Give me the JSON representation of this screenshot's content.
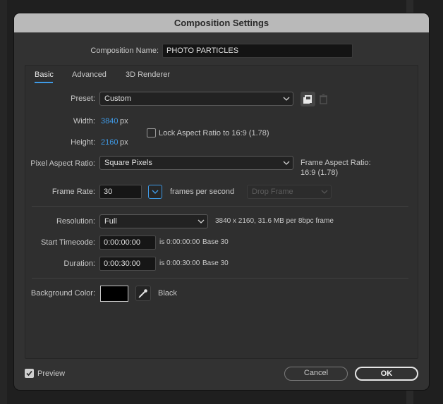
{
  "dialog": {
    "title": "Composition Settings"
  },
  "composition_name": {
    "label": "Composition Name:",
    "value": "PHOTO PARTICLES"
  },
  "tabs": [
    {
      "label": "Basic",
      "active": true
    },
    {
      "label": "Advanced",
      "active": false
    },
    {
      "label": "3D Renderer",
      "active": false
    }
  ],
  "preset": {
    "label": "Preset:",
    "value": "Custom"
  },
  "width": {
    "label": "Width:",
    "value": "3840",
    "unit": "px"
  },
  "height": {
    "label": "Height:",
    "value": "2160",
    "unit": "px"
  },
  "lock_aspect": {
    "label": "Lock Aspect Ratio to 16:9 (1.78)",
    "checked": false
  },
  "pixel_aspect": {
    "label": "Pixel Aspect Ratio:",
    "value": "Square Pixels",
    "frame_aspect_label": "Frame Aspect Ratio:",
    "frame_aspect_value": "16:9 (1.78)"
  },
  "frame_rate": {
    "label": "Frame Rate:",
    "value": "30",
    "unit": "frames per second",
    "drop_frame": "Drop Frame"
  },
  "resolution": {
    "label": "Resolution:",
    "value": "Full",
    "info": "3840 x 2160, 31.6 MB per 8bpc frame"
  },
  "start_timecode": {
    "label": "Start Timecode:",
    "value": "0:00:00:00",
    "info_is": "is 0:00:00:00",
    "base": "Base 30"
  },
  "duration": {
    "label": "Duration:",
    "value": "0:00:30:00",
    "info_is": "is 0:00:30:00",
    "base": "Base 30"
  },
  "background_color": {
    "label": "Background Color:",
    "color": "#000000",
    "name": "Black"
  },
  "footer": {
    "preview_label": "Preview",
    "preview_checked": true,
    "cancel_label": "Cancel",
    "ok_label": "OK"
  },
  "colors": {
    "accent": "#3f9ae6",
    "titlebar": "#b9b9b9",
    "dialog_bg": "#323232"
  }
}
